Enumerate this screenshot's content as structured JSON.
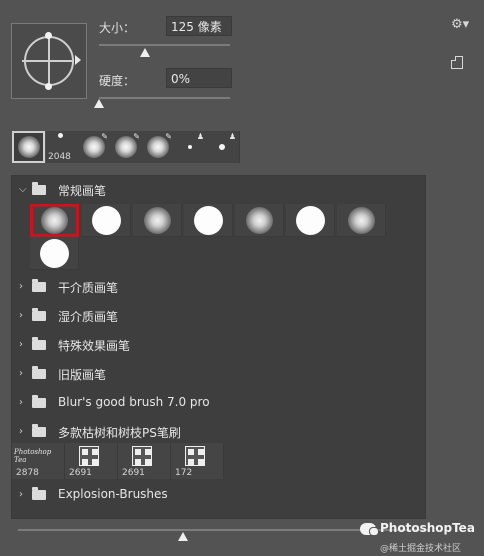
{
  "controls": {
    "size_label": "大小：",
    "size_value": "125 像素",
    "size_level": 0.35,
    "hardness_label": "硬度：",
    "hardness_value": "0%",
    "hardness_level": 0.0
  },
  "icons": {
    "gear": "gear-icon",
    "new_preset": "new-preset-icon",
    "brush_tip_preview": "brush-angle-preview-icon"
  },
  "recent_brushes": [
    {
      "type": "soft",
      "selected": true
    },
    {
      "type": "scatter",
      "count": "2048"
    },
    {
      "type": "soft-pen"
    },
    {
      "type": "soft-pen"
    },
    {
      "type": "soft-pen"
    },
    {
      "type": "small-dot"
    },
    {
      "type": "small-dot"
    }
  ],
  "groups": [
    {
      "name": "常规画笔",
      "expanded": true
    },
    {
      "name": "干介质画笔",
      "expanded": false
    },
    {
      "name": "湿介质画笔",
      "expanded": false
    },
    {
      "name": "特殊效果画笔",
      "expanded": false
    },
    {
      "name": "旧版画笔",
      "expanded": false
    },
    {
      "name": "Blur's good brush 7.0 pro",
      "expanded": false
    },
    {
      "name": "多款枯树和树枝PS笔刷",
      "expanded": false
    },
    {
      "name": "Explosion-Brushes",
      "expanded": false
    }
  ],
  "general_brushes": [
    "soft",
    "hard",
    "soft",
    "hard",
    "soft",
    "hard",
    "soft",
    "hard"
  ],
  "custom_brushes": [
    {
      "label": "Photoshop Tea",
      "count": "2878"
    },
    {
      "count": "2691"
    },
    {
      "count": "2691"
    },
    {
      "count": "172"
    }
  ],
  "watermark": {
    "name": "PhotoshopTea",
    "sub": "@稀土掘金技术社区"
  },
  "colors": {
    "selected_outline": "#c8141e",
    "panel_bg": "#535353",
    "list_bg": "#3e3e3e"
  }
}
